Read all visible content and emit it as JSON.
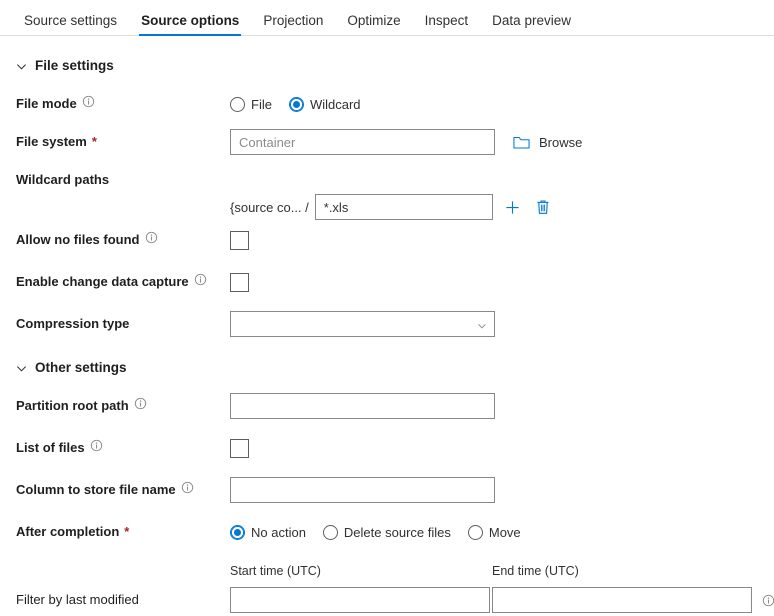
{
  "tabs": [
    {
      "label": "Source settings",
      "active": false
    },
    {
      "label": "Source options",
      "active": true
    },
    {
      "label": "Projection",
      "active": false
    },
    {
      "label": "Optimize",
      "active": false
    },
    {
      "label": "Inspect",
      "active": false
    },
    {
      "label": "Data preview",
      "active": false
    }
  ],
  "colors": {
    "accent": "#0078d4",
    "required_asterisk": "#a4262c",
    "border": "#8a8886",
    "text": "#323130"
  },
  "sections": {
    "file_settings": {
      "title": "File settings",
      "file_mode": {
        "label": "File mode",
        "info": "ⓘ",
        "options": [
          {
            "label": "File",
            "selected": false
          },
          {
            "label": "Wildcard",
            "selected": true
          }
        ]
      },
      "file_system": {
        "label": "File system",
        "required": "*",
        "placeholder": "Container",
        "value": "",
        "browse_label": "Browse"
      },
      "wildcard_paths": {
        "label": "Wildcard paths",
        "prefix": "{source co... /",
        "value": "*.xls",
        "placeholder": "",
        "add_label": "+",
        "delete_label": "Delete"
      },
      "allow_no_files_found": {
        "label": "Allow no files found",
        "checked": false
      },
      "enable_cdc": {
        "label": "Enable change data capture",
        "checked": false
      },
      "compression_type": {
        "label": "Compression type",
        "value": "",
        "placeholder": ""
      }
    },
    "other_settings": {
      "title": "Other settings",
      "partition_root_path": {
        "label": "Partition root path",
        "value": "",
        "placeholder": ""
      },
      "list_of_files": {
        "label": "List of files",
        "checked": false
      },
      "column_to_store_file_name": {
        "label": "Column to store file name",
        "value": "",
        "placeholder": ""
      },
      "after_completion": {
        "label": "After completion",
        "required": "*",
        "options": [
          {
            "label": "No action",
            "selected": true
          },
          {
            "label": "Delete source files",
            "selected": false
          },
          {
            "label": "Move",
            "selected": false
          }
        ]
      },
      "filter_by_last_modified": {
        "label": "Filter by last modified",
        "start_header": "Start time (UTC)",
        "end_header": "End time (UTC)",
        "start_value": "",
        "end_value": "",
        "start_placeholder": "",
        "end_placeholder": ""
      }
    }
  }
}
